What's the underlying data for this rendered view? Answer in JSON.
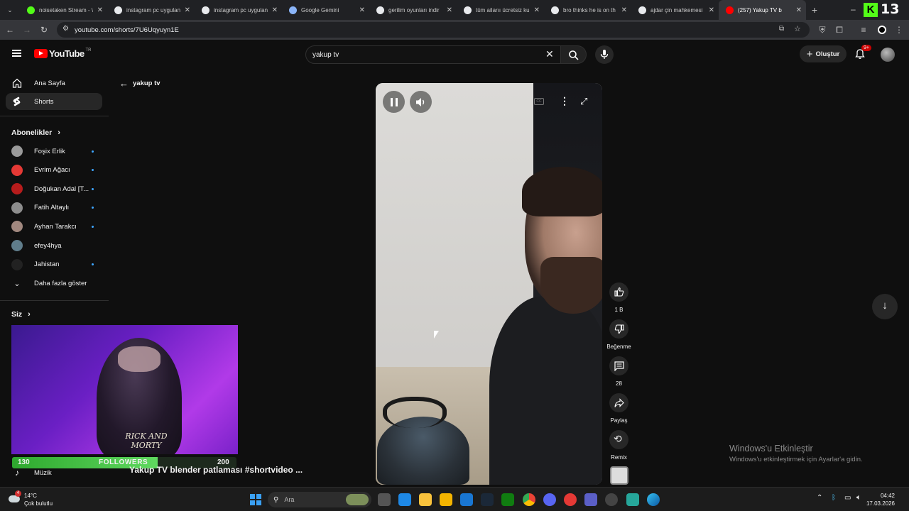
{
  "browser": {
    "tabs": [
      {
        "title": "noisetaken Stream - \\",
        "color": "#53fc18"
      },
      {
        "title": "instagram pc uygulan",
        "color": "#e8eaed"
      },
      {
        "title": "instagram pc uygulan",
        "color": "#e8eaed"
      },
      {
        "title": "Google Gemini",
        "color": "#8ab4f8"
      },
      {
        "title": "gerilim oyunları indir",
        "color": "#e8eaed"
      },
      {
        "title": "tüm ailarıı ücretsiz ku",
        "color": "#e8eaed"
      },
      {
        "title": "bro thinks he is on th",
        "color": "#e8eaed"
      },
      {
        "title": "ajdar çin mahkemesi",
        "color": "#e8eaed"
      },
      {
        "title": "(257) Yakup TV b",
        "color": "#ff0000",
        "active": true
      }
    ],
    "url": "youtube.com/shorts/7U6Uqyuyn1E",
    "overlay_counter": "13"
  },
  "youtube": {
    "logo_text": "YouTube",
    "region": "TR",
    "search_value": "yakup tv",
    "create_label": "Oluştur",
    "notification_count": "9+",
    "nav": [
      {
        "label": "Ana Sayfa",
        "icon": "home-icon"
      },
      {
        "label": "Shorts",
        "icon": "shorts-icon",
        "selected": true
      }
    ],
    "subscriptions_header": "Abonelikler",
    "subscriptions": [
      {
        "name": "Foşix Erlik",
        "color": "#9a9a9a"
      },
      {
        "name": "Evrim Ağacı",
        "color": "#e53935"
      },
      {
        "name": "Doğukan Adal [T...",
        "color": "#b71c1c"
      },
      {
        "name": "Fatih Altaylı",
        "color": "#8d8d8d"
      },
      {
        "name": "Ayhan Tarakcı",
        "color": "#a1887f"
      },
      {
        "name": "efey4hya",
        "color": "#607d8b"
      },
      {
        "name": "Jahistan",
        "color": "#222222"
      }
    ],
    "show_more_label": "Daha fazla göster",
    "you_header": "Siz",
    "music_label": "Müzik",
    "back_label": "yakup tv",
    "video_title": "Yakup TV blender patlaması #shortvideo ...",
    "actions": {
      "like_count": "1 B",
      "dislike_label": "Beğenme",
      "comment_count": "28",
      "share_label": "Paylaş",
      "remix_label": "Remix"
    }
  },
  "stream_overlay": {
    "followers_label": "FOLLOWERS",
    "followers_current": "130",
    "followers_goal": "200",
    "followers_progress": 0.65,
    "shirt_text": "RICK AND MORTY"
  },
  "windows": {
    "activate_title": "Windows'u Etkinleştir",
    "activate_sub": "Windows'u etkinleştirmek için Ayarlar'a gidin.",
    "weather_temp": "14°C",
    "weather_desc": "Çok bulutlu",
    "weather_badge": "4",
    "search_placeholder": "Ara",
    "time": "04:42",
    "date": "17.03.2026"
  }
}
